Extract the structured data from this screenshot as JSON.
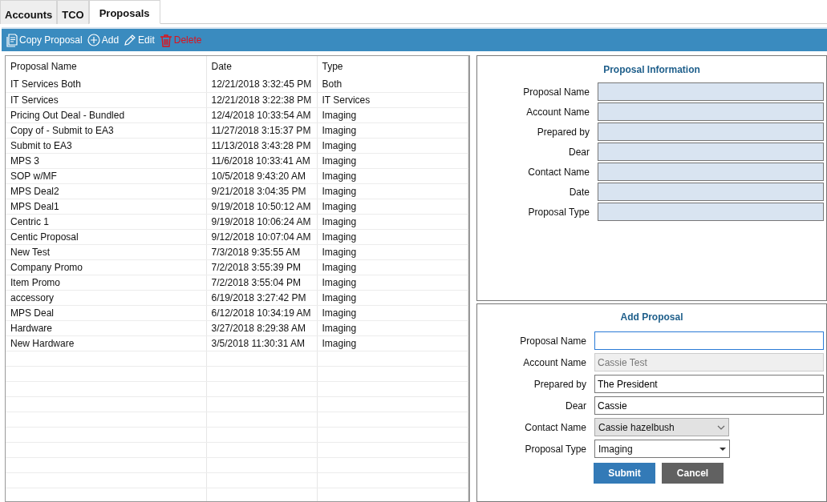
{
  "tabs": [
    {
      "label": "Accounts",
      "selected": false
    },
    {
      "label": "TCO",
      "selected": false
    },
    {
      "label": "Proposals",
      "selected": true
    }
  ],
  "toolbar": [
    {
      "kind": "copy",
      "label": "Copy Proposal"
    },
    {
      "kind": "add",
      "label": "Add"
    },
    {
      "kind": "edit",
      "label": "Edit"
    },
    {
      "kind": "delete",
      "label": "Delete"
    }
  ],
  "table": {
    "columns": [
      "Proposal Name",
      "Date",
      "Type"
    ],
    "rows": [
      [
        "IT Services Both",
        "12/21/2018 3:32:45 PM",
        "Both"
      ],
      [
        "IT Services",
        "12/21/2018 3:22:38 PM",
        "IT Services"
      ],
      [
        "Pricing Out Deal - Bundled",
        "12/4/2018 10:33:54 AM",
        "Imaging"
      ],
      [
        "Copy of - Submit to EA3",
        "11/27/2018 3:15:37 PM",
        "Imaging"
      ],
      [
        "Submit to EA3",
        "11/13/2018 3:43:28 PM",
        "Imaging"
      ],
      [
        "MPS 3",
        "11/6/2018 10:33:41 AM",
        "Imaging"
      ],
      [
        "SOP w/MF",
        "10/5/2018 9:43:20 AM",
        "Imaging"
      ],
      [
        "MPS Deal2",
        "9/21/2018 3:04:35 PM",
        "Imaging"
      ],
      [
        "MPS Deal1",
        "9/19/2018 10:50:12 AM",
        "Imaging"
      ],
      [
        "Centric 1",
        "9/19/2018 10:06:24 AM",
        "Imaging"
      ],
      [
        "Centic Proposal",
        "9/12/2018 10:07:04 AM",
        "Imaging"
      ],
      [
        "New Test",
        "7/3/2018 9:35:55 AM",
        "Imaging"
      ],
      [
        "Company Promo",
        "7/2/2018 3:55:39 PM",
        "Imaging"
      ],
      [
        "Item Promo",
        "7/2/2018 3:55:04 PM",
        "Imaging"
      ],
      [
        "accessory",
        "6/19/2018 3:27:42 PM",
        "Imaging"
      ],
      [
        "MPS Deal",
        "6/12/2018 10:34:19 AM",
        "Imaging"
      ],
      [
        "Hardware",
        "3/27/2018 8:29:38 AM",
        "Imaging"
      ],
      [
        "New Hardware",
        "3/5/2018 11:30:31 AM",
        "Imaging"
      ]
    ]
  },
  "proposal_information": {
    "title": "Proposal Information",
    "fields": [
      {
        "label": "Proposal Name"
      },
      {
        "label": "Account Name"
      },
      {
        "label": "Prepared by"
      },
      {
        "label": "Dear"
      },
      {
        "label": "Contact Name"
      },
      {
        "label": "Date"
      },
      {
        "label": "Proposal Type"
      }
    ]
  },
  "add_proposal": {
    "title": "Add Proposal",
    "fields": [
      {
        "kind": "text",
        "label": "Proposal Name",
        "focused": true,
        "disabled": false
      },
      {
        "kind": "text",
        "label": "Account Name",
        "value": "Cassie Test",
        "focused": false,
        "disabled": true
      },
      {
        "kind": "text",
        "label": "Prepared by",
        "value": "The President",
        "focused": false,
        "disabled": false
      },
      {
        "kind": "text",
        "label": "Dear",
        "value": "Cassie",
        "focused": false,
        "disabled": false
      },
      {
        "kind": "combo",
        "label": "Contact Name",
        "value": "Cassie hazelbush"
      },
      {
        "kind": "select",
        "label": "Proposal Type",
        "value": "Imaging"
      }
    ],
    "buttons": [
      {
        "kind": "primary",
        "label": "Submit"
      },
      {
        "kind": "secondary",
        "label": "Cancel"
      }
    ]
  }
}
